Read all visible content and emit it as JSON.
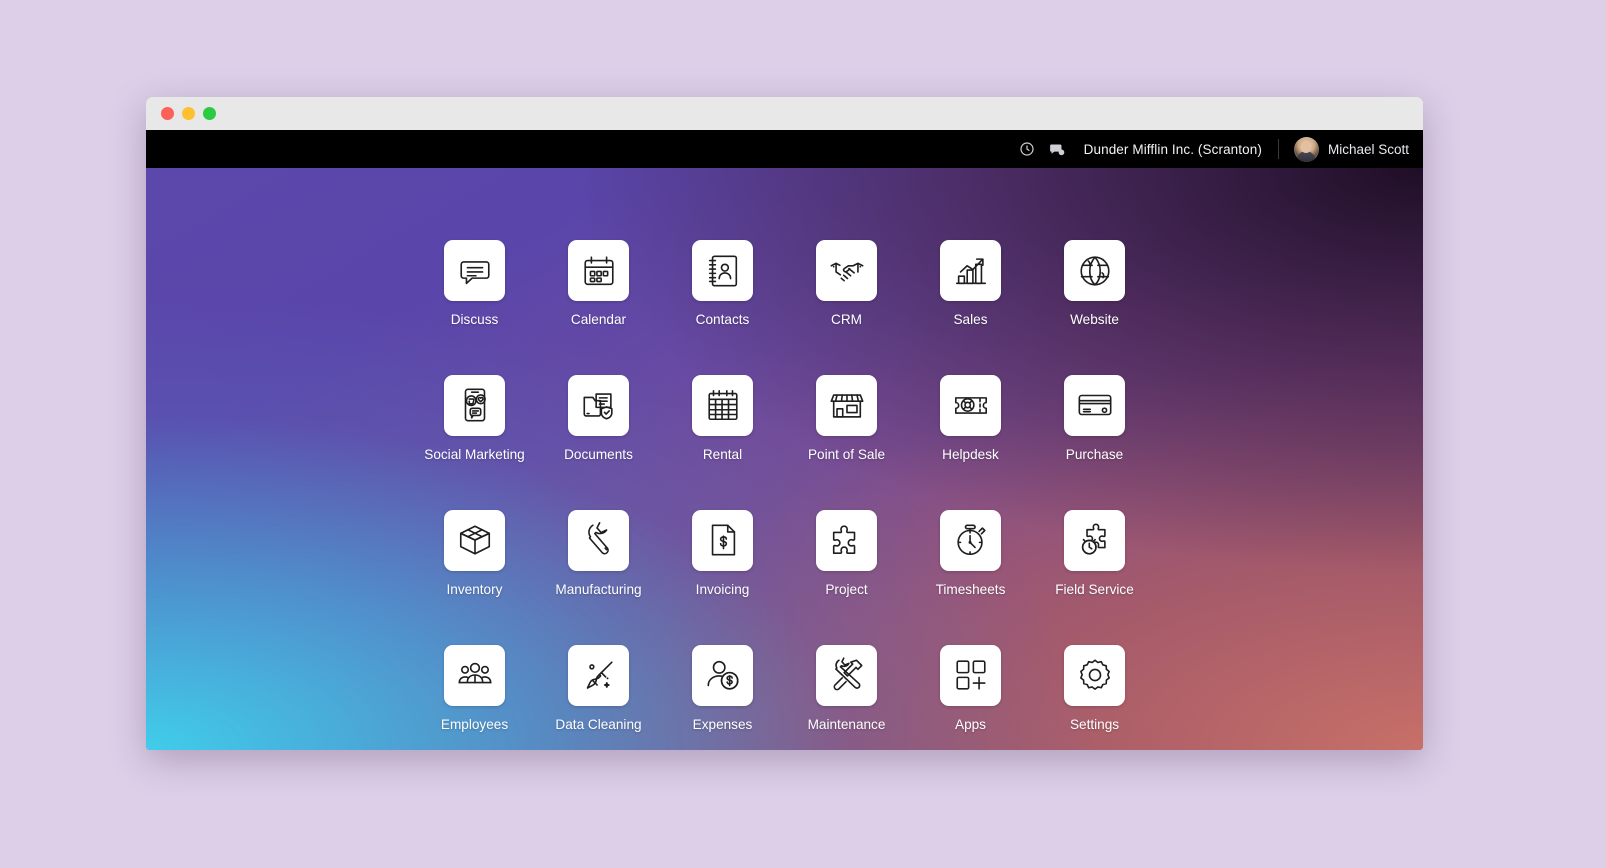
{
  "window": {
    "traffic_lights": [
      {
        "name": "close",
        "color": "#fc6058"
      },
      {
        "name": "minimize",
        "color": "#fec02f"
      },
      {
        "name": "maximize",
        "color": "#2aca41"
      }
    ]
  },
  "navbar": {
    "activity_icon": "clock-icon",
    "messages_icon": "chat-bubble-icon",
    "company": "Dunder Mifflin Inc. (Scranton)",
    "user_name": "Michael Scott",
    "avatar": "user-avatar",
    "background": "#000000",
    "text_color": "#f2f2f5"
  },
  "desktop": {
    "gradient": {
      "top_left": "#5446a8",
      "top_right": "#2b1a2e",
      "bottom_left": "#4ac7e8",
      "bottom_right": "#b55f5f"
    }
  },
  "apps": [
    {
      "label": "Discuss",
      "icon": "discuss-icon"
    },
    {
      "label": "Calendar",
      "icon": "calendar-icon"
    },
    {
      "label": "Contacts",
      "icon": "contacts-icon"
    },
    {
      "label": "CRM",
      "icon": "handshake-icon"
    },
    {
      "label": "Sales",
      "icon": "bar-chart-arrow-icon"
    },
    {
      "label": "Website",
      "icon": "globe-icon"
    },
    {
      "label": "Social Marketing",
      "icon": "phone-social-icon"
    },
    {
      "label": "Documents",
      "icon": "folder-shield-icon"
    },
    {
      "label": "Rental",
      "icon": "calendar-grid-icon"
    },
    {
      "label": "Point of Sale",
      "icon": "storefront-icon"
    },
    {
      "label": "Helpdesk",
      "icon": "ticket-lifebuoy-icon"
    },
    {
      "label": "Purchase",
      "icon": "credit-card-icon"
    },
    {
      "label": "Inventory",
      "icon": "open-box-icon"
    },
    {
      "label": "Manufacturing",
      "icon": "wrench-icon"
    },
    {
      "label": "Invoicing",
      "icon": "dollar-document-icon"
    },
    {
      "label": "Project",
      "icon": "puzzle-piece-icon"
    },
    {
      "label": "Timesheets",
      "icon": "stopwatch-icon"
    },
    {
      "label": "Field Service",
      "icon": "puzzle-clock-icon"
    },
    {
      "label": "Employees",
      "icon": "people-group-icon"
    },
    {
      "label": "Data Cleaning",
      "icon": "broom-sparkle-icon"
    },
    {
      "label": "Expenses",
      "icon": "person-dollar-icon"
    },
    {
      "label": "Maintenance",
      "icon": "hammer-wrench-icon"
    },
    {
      "label": "Apps",
      "icon": "grid-plus-icon"
    },
    {
      "label": "Settings",
      "icon": "gear-icon"
    }
  ]
}
